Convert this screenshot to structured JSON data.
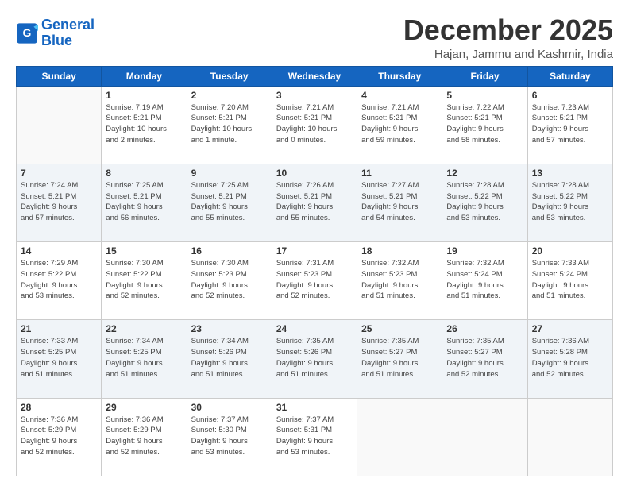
{
  "header": {
    "logo_line1": "General",
    "logo_line2": "Blue",
    "month": "December 2025",
    "location": "Hajan, Jammu and Kashmir, India"
  },
  "weekdays": [
    "Sunday",
    "Monday",
    "Tuesday",
    "Wednesday",
    "Thursday",
    "Friday",
    "Saturday"
  ],
  "weeks": [
    [
      {
        "day": "",
        "info": ""
      },
      {
        "day": "1",
        "info": "Sunrise: 7:19 AM\nSunset: 5:21 PM\nDaylight: 10 hours\nand 2 minutes."
      },
      {
        "day": "2",
        "info": "Sunrise: 7:20 AM\nSunset: 5:21 PM\nDaylight: 10 hours\nand 1 minute."
      },
      {
        "day": "3",
        "info": "Sunrise: 7:21 AM\nSunset: 5:21 PM\nDaylight: 10 hours\nand 0 minutes."
      },
      {
        "day": "4",
        "info": "Sunrise: 7:21 AM\nSunset: 5:21 PM\nDaylight: 9 hours\nand 59 minutes."
      },
      {
        "day": "5",
        "info": "Sunrise: 7:22 AM\nSunset: 5:21 PM\nDaylight: 9 hours\nand 58 minutes."
      },
      {
        "day": "6",
        "info": "Sunrise: 7:23 AM\nSunset: 5:21 PM\nDaylight: 9 hours\nand 57 minutes."
      }
    ],
    [
      {
        "day": "7",
        "info": "Sunrise: 7:24 AM\nSunset: 5:21 PM\nDaylight: 9 hours\nand 57 minutes."
      },
      {
        "day": "8",
        "info": "Sunrise: 7:25 AM\nSunset: 5:21 PM\nDaylight: 9 hours\nand 56 minutes."
      },
      {
        "day": "9",
        "info": "Sunrise: 7:25 AM\nSunset: 5:21 PM\nDaylight: 9 hours\nand 55 minutes."
      },
      {
        "day": "10",
        "info": "Sunrise: 7:26 AM\nSunset: 5:21 PM\nDaylight: 9 hours\nand 55 minutes."
      },
      {
        "day": "11",
        "info": "Sunrise: 7:27 AM\nSunset: 5:21 PM\nDaylight: 9 hours\nand 54 minutes."
      },
      {
        "day": "12",
        "info": "Sunrise: 7:28 AM\nSunset: 5:22 PM\nDaylight: 9 hours\nand 53 minutes."
      },
      {
        "day": "13",
        "info": "Sunrise: 7:28 AM\nSunset: 5:22 PM\nDaylight: 9 hours\nand 53 minutes."
      }
    ],
    [
      {
        "day": "14",
        "info": "Sunrise: 7:29 AM\nSunset: 5:22 PM\nDaylight: 9 hours\nand 53 minutes."
      },
      {
        "day": "15",
        "info": "Sunrise: 7:30 AM\nSunset: 5:22 PM\nDaylight: 9 hours\nand 52 minutes."
      },
      {
        "day": "16",
        "info": "Sunrise: 7:30 AM\nSunset: 5:23 PM\nDaylight: 9 hours\nand 52 minutes."
      },
      {
        "day": "17",
        "info": "Sunrise: 7:31 AM\nSunset: 5:23 PM\nDaylight: 9 hours\nand 52 minutes."
      },
      {
        "day": "18",
        "info": "Sunrise: 7:32 AM\nSunset: 5:23 PM\nDaylight: 9 hours\nand 51 minutes."
      },
      {
        "day": "19",
        "info": "Sunrise: 7:32 AM\nSunset: 5:24 PM\nDaylight: 9 hours\nand 51 minutes."
      },
      {
        "day": "20",
        "info": "Sunrise: 7:33 AM\nSunset: 5:24 PM\nDaylight: 9 hours\nand 51 minutes."
      }
    ],
    [
      {
        "day": "21",
        "info": "Sunrise: 7:33 AM\nSunset: 5:25 PM\nDaylight: 9 hours\nand 51 minutes."
      },
      {
        "day": "22",
        "info": "Sunrise: 7:34 AM\nSunset: 5:25 PM\nDaylight: 9 hours\nand 51 minutes."
      },
      {
        "day": "23",
        "info": "Sunrise: 7:34 AM\nSunset: 5:26 PM\nDaylight: 9 hours\nand 51 minutes."
      },
      {
        "day": "24",
        "info": "Sunrise: 7:35 AM\nSunset: 5:26 PM\nDaylight: 9 hours\nand 51 minutes."
      },
      {
        "day": "25",
        "info": "Sunrise: 7:35 AM\nSunset: 5:27 PM\nDaylight: 9 hours\nand 51 minutes."
      },
      {
        "day": "26",
        "info": "Sunrise: 7:35 AM\nSunset: 5:27 PM\nDaylight: 9 hours\nand 52 minutes."
      },
      {
        "day": "27",
        "info": "Sunrise: 7:36 AM\nSunset: 5:28 PM\nDaylight: 9 hours\nand 52 minutes."
      }
    ],
    [
      {
        "day": "28",
        "info": "Sunrise: 7:36 AM\nSunset: 5:29 PM\nDaylight: 9 hours\nand 52 minutes."
      },
      {
        "day": "29",
        "info": "Sunrise: 7:36 AM\nSunset: 5:29 PM\nDaylight: 9 hours\nand 52 minutes."
      },
      {
        "day": "30",
        "info": "Sunrise: 7:37 AM\nSunset: 5:30 PM\nDaylight: 9 hours\nand 53 minutes."
      },
      {
        "day": "31",
        "info": "Sunrise: 7:37 AM\nSunset: 5:31 PM\nDaylight: 9 hours\nand 53 minutes."
      },
      {
        "day": "",
        "info": ""
      },
      {
        "day": "",
        "info": ""
      },
      {
        "day": "",
        "info": ""
      }
    ]
  ]
}
